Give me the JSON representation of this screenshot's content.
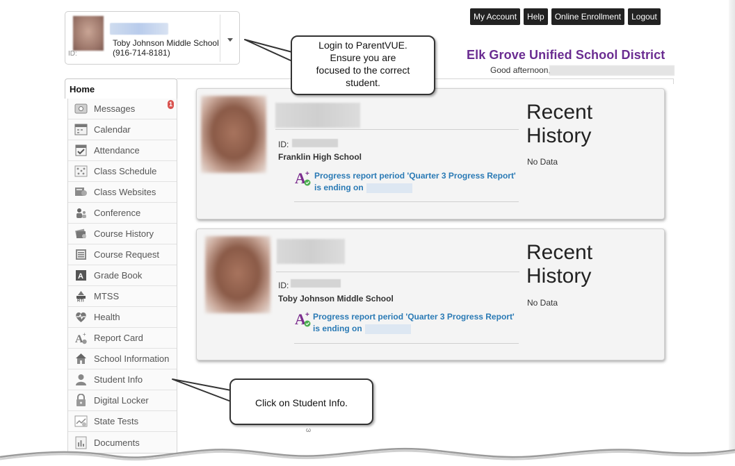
{
  "student_selector": {
    "school": "Toby Johnson Middle School",
    "phone": "(916-714-8181)",
    "id_label": "ID:"
  },
  "topnav": {
    "my_account": "My Account",
    "help": "Help",
    "online_enrollment": "Online Enrollment",
    "logout": "Logout"
  },
  "header": {
    "district": "Elk Grove Unified School District",
    "greeting": "Good afternoon,"
  },
  "callouts": {
    "login": "Login to ParentVUE.\nEnsure you are\nfocused to the correct\nstudent.",
    "student_info": "Click on Student Info."
  },
  "home_tab": "Home",
  "sidebar": {
    "items": [
      {
        "label": "Messages",
        "icon": "messages-icon",
        "badge": "1"
      },
      {
        "label": "Calendar",
        "icon": "calendar-icon"
      },
      {
        "label": "Attendance",
        "icon": "attendance-icon"
      },
      {
        "label": "Class Schedule",
        "icon": "class-schedule-icon"
      },
      {
        "label": "Class Websites",
        "icon": "class-websites-icon"
      },
      {
        "label": "Conference",
        "icon": "conference-icon"
      },
      {
        "label": "Course History",
        "icon": "course-history-icon"
      },
      {
        "label": "Course Request",
        "icon": "course-request-icon"
      },
      {
        "label": "Grade Book",
        "icon": "grade-book-icon"
      },
      {
        "label": "MTSS",
        "icon": "mtss-icon"
      },
      {
        "label": "Health",
        "icon": "health-icon"
      },
      {
        "label": "Report Card",
        "icon": "report-card-icon"
      },
      {
        "label": "School Information",
        "icon": "school-information-icon"
      },
      {
        "label": "Student Info",
        "icon": "student-info-icon"
      },
      {
        "label": "Digital Locker",
        "icon": "digital-locker-icon"
      },
      {
        "label": "State Tests",
        "icon": "state-tests-icon"
      },
      {
        "label": "Documents",
        "icon": "documents-icon"
      }
    ]
  },
  "cards": [
    {
      "id_label": "ID:",
      "school": "Franklin High School",
      "progress": "Progress report period 'Quarter 3 Progress Report' is ending on",
      "recent_history_title": "Recent History",
      "recent_history_empty": "No Data"
    },
    {
      "id_label": "ID:",
      "school": "Toby Johnson Middle School",
      "progress": "Progress report period 'Quarter 3 Progress Report' is ending on",
      "recent_history_title": "Recent History",
      "recent_history_empty": "No Data"
    }
  ],
  "colors": {
    "district": "#6a2c91",
    "link": "#2a7ab5",
    "badge": "#d9534f",
    "topnav_bg": "#222222"
  }
}
